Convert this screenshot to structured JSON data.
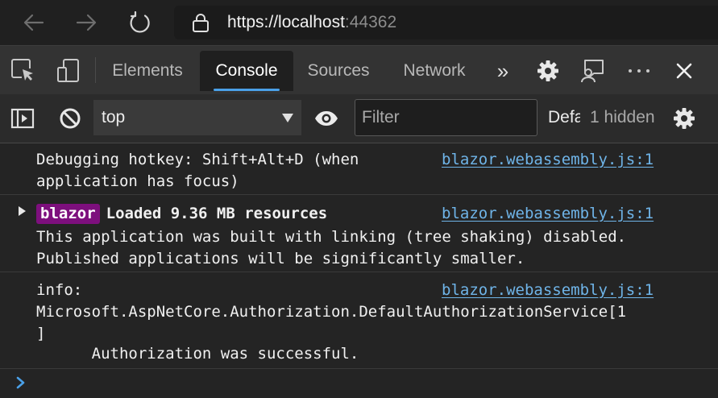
{
  "browser": {
    "url_main": "https://localhost",
    "url_port": ":44362"
  },
  "devtools": {
    "tabs": [
      {
        "label": "Elements",
        "active": false
      },
      {
        "label": "Console",
        "active": true
      },
      {
        "label": "Sources",
        "active": false
      },
      {
        "label": "Network",
        "active": false
      }
    ],
    "more_tabs_glyph": "»"
  },
  "console_toolbar": {
    "context_value": "top",
    "filter_placeholder": "Filter",
    "levels_label": "Default levels",
    "hidden_count": "1 hidden"
  },
  "messages": [
    {
      "lines": [
        "Debugging hotkey: Shift+Alt+D (when",
        "application has focus)"
      ],
      "source": "blazor.webassembly.js:1"
    },
    {
      "badge": "blazor",
      "headline": "Loaded 9.36 MB resources",
      "lines": [
        "This application was built with linking (tree shaking) disabled.",
        "Published applications will be significantly smaller."
      ],
      "source": "blazor.webassembly.js:1",
      "expandable": true
    },
    {
      "lines": [
        "info:",
        "Microsoft.AspNetCore.Authorization.DefaultAuthorizationService[1",
        "]",
        "      Authorization was successful."
      ],
      "source": "blazor.webassembly.js:1"
    }
  ],
  "colors": {
    "accent": "#4aa0e8",
    "badge_bg": "#7d0f7d",
    "link": "#6fb4e8"
  },
  "icons": {
    "back": "arrow-left-icon",
    "forward": "arrow-right-icon",
    "refresh": "refresh-icon",
    "lock": "lock-icon",
    "inspect": "inspect-element-icon",
    "device": "device-emulation-icon",
    "settings": "gear-icon",
    "feedback": "feedback-icon",
    "more": "more-options-icon",
    "close": "close-icon",
    "sidebar": "show-sidebar-icon",
    "clear": "clear-console-icon",
    "live_expression": "eye-icon",
    "console_settings": "gear-icon",
    "prompt": "chevron-right-icon",
    "expand": "triangle-right-icon"
  }
}
